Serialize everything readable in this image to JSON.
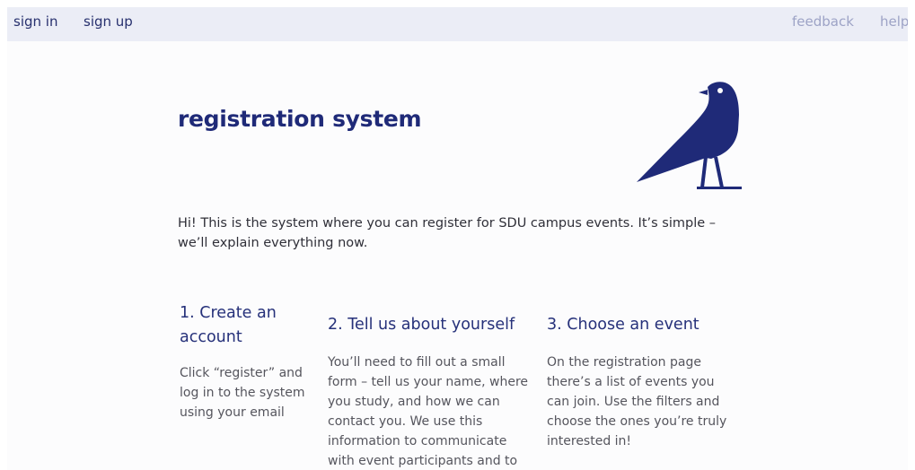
{
  "nav": {
    "sign_in": "sign in",
    "sign_up": "sign up",
    "feedback": "feedback",
    "help": "help"
  },
  "hero": {
    "title": "registration system",
    "logo_icon": "raven-icon"
  },
  "intro": "Hi! This is the system where you can register for SDU campus events. It’s simple – we’ll explain everything now.",
  "steps": [
    {
      "title": "1. Create an account",
      "body": "Click “register” and log in to the system using your email"
    },
    {
      "title": "2. Tell us about yourself",
      "body": "You’ll need to fill out a small form – tell us your name, where you study, and how we can contact you. We use this information to communicate with event participants and to"
    },
    {
      "title": "3. Choose an event",
      "body": "On the registration page there’s a list of events you can join. Use the filters and choose the ones you’re truly interested in!"
    }
  ],
  "colors": {
    "accent": "#1f2a78",
    "topbar": "#ebedf6",
    "muted_link": "#9da3c6"
  }
}
